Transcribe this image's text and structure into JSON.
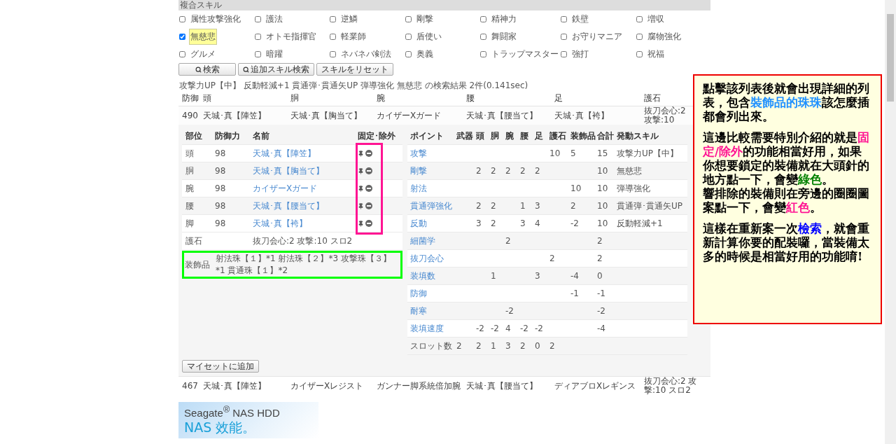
{
  "skill_section": {
    "title": "複合スキル",
    "skills": [
      {
        "label": "属性攻撃強化",
        "checked": false
      },
      {
        "label": "護法",
        "checked": false
      },
      {
        "label": "逆鱗",
        "checked": false
      },
      {
        "label": "剛撃",
        "checked": false
      },
      {
        "label": "精神力",
        "checked": false
      },
      {
        "label": "鉄壁",
        "checked": false
      },
      {
        "label": "増収",
        "checked": false
      },
      {
        "label": "無慈悲",
        "checked": true
      },
      {
        "label": "オトモ指揮官",
        "checked": false
      },
      {
        "label": "軽業師",
        "checked": false
      },
      {
        "label": "盾使い",
        "checked": false
      },
      {
        "label": "舞闘家",
        "checked": false
      },
      {
        "label": "お守りマニア",
        "checked": false
      },
      {
        "label": "腐物強化",
        "checked": false
      },
      {
        "label": "グルメ",
        "checked": false
      },
      {
        "label": "暗躍",
        "checked": false
      },
      {
        "label": "ネバネバ剣法",
        "checked": false
      },
      {
        "label": "奥義",
        "checked": false
      },
      {
        "label": "トラップマスター",
        "checked": false
      },
      {
        "label": "強打",
        "checked": false
      },
      {
        "label": "祝福",
        "checked": false
      }
    ]
  },
  "buttons": [
    {
      "label": "検索",
      "kind": "search"
    },
    {
      "label": "追加スキル検索",
      "kind": "search"
    },
    {
      "label": "スキルをリセット",
      "kind": "plain"
    }
  ],
  "result_summary": "攻撃力UP【中】 反動軽減+1 貫通弾･貫通矢UP 弾導強化 無慈悲 の検索結果 2件(0.141sec)",
  "results": {
    "columns": [
      "防御",
      "頭",
      "胴",
      "腕",
      "腰",
      "足",
      "護石"
    ],
    "rows": [
      {
        "expanded": true,
        "cells": [
          "490",
          "天城･真【陣笠】",
          "天城･真【胸当て】",
          "カイザーXガード",
          "天城･真【腰当て】",
          "天城･真【袴】",
          "抜刀会心:2 攻撃:10"
        ],
        "detail": {
          "parts_table": {
            "columns": [
              "部位",
              "防御力",
              "名前",
              "固定･除外"
            ],
            "rows": [
              {
                "part": "頭",
                "defense": "98",
                "name": "天城･真【陣笠】"
              },
              {
                "part": "胴",
                "defense": "98",
                "name": "天城･真【胸当て】"
              },
              {
                "part": "腕",
                "defense": "98",
                "name": "カイザーXガード"
              },
              {
                "part": "腰",
                "defense": "98",
                "name": "天城･真【腰当て】"
              },
              {
                "part": "脚",
                "defense": "98",
                "name": "天城･真【袴】"
              }
            ],
            "charm": {
              "label": "護石",
              "text": "抜刀会心:2 攻撃:10 スロ2"
            },
            "decorations": {
              "label": "装飾品",
              "text": "射法珠【１】*1 射法珠【２】*3 攻撃珠【３】*1 貫通珠【１】*2"
            }
          },
          "points_table": {
            "columns": [
              "ポイント",
              "武器",
              "頭",
              "胴",
              "腕",
              "腰",
              "足",
              "護石",
              "装飾品",
              "合計",
              "発動スキル"
            ],
            "rows": [
              {
                "kind": "skill",
                "point": "攻撃",
                "values": {
                  "charm": "10",
                  "decorations": "5",
                  "total": "15"
                },
                "skill": "攻撃力UP【中】"
              },
              {
                "kind": "skill",
                "point": "剛撃",
                "values": {
                  "head": "2",
                  "body": "2",
                  "arm": "2",
                  "waist": "2",
                  "leg": "2",
                  "total": "10"
                },
                "skill": "無慈悲"
              },
              {
                "kind": "skill",
                "point": "射法",
                "values": {
                  "decorations": "10",
                  "total": "10"
                },
                "skill": "弾導強化"
              },
              {
                "kind": "skill",
                "point": "貫通弾強化",
                "values": {
                  "head": "2",
                  "body": "2",
                  "waist": "1",
                  "leg": "3",
                  "decorations": "2",
                  "total": "10"
                },
                "skill": "貫通弾･貫通矢UP"
              },
              {
                "kind": "skill",
                "point": "反動",
                "values": {
                  "head": "3",
                  "body": "2",
                  "waist": "3",
                  "leg": "4",
                  "decorations": "-2",
                  "total": "10"
                },
                "skill": "反動軽減+1"
              },
              {
                "kind": "skill",
                "point": "細菌学",
                "values": {
                  "arm": "2",
                  "total": "2"
                }
              },
              {
                "kind": "skill",
                "point": "抜刀会心",
                "values": {
                  "charm": "2",
                  "total": "2"
                }
              },
              {
                "kind": "skill",
                "point": "装填数",
                "values": {
                  "body": "1",
                  "leg": "3",
                  "decorations": "-4",
                  "total": "0"
                }
              },
              {
                "kind": "skill",
                "point": "防御",
                "values": {
                  "decorations": "-1",
                  "total": "-1"
                }
              },
              {
                "kind": "skill",
                "point": "耐寒",
                "values": {
                  "arm": "-2",
                  "total": "-2"
                }
              },
              {
                "kind": "skill",
                "point": "装填速度",
                "values": {
                  "head": "-2",
                  "body": "-2",
                  "arm": "4",
                  "waist": "-2",
                  "leg": "-2",
                  "total": "-4"
                }
              },
              {
                "kind": "slots",
                "point": "スロット数",
                "values": {
                  "weapon": "2",
                  "head": "2",
                  "body": "1",
                  "arm": "3",
                  "waist": "2",
                  "leg": "0",
                  "charm": "2"
                }
              }
            ]
          },
          "add_button": "マイセットに追加"
        }
      },
      {
        "expanded": false,
        "cells": [
          "467",
          "天城･真【陣笠】",
          "カイザーXレジスト",
          "ガンナー脚系統倍加腕",
          "天城･真【腰当て】",
          "ディアブロXレギンス",
          "抜刀会心:2 攻撃:10 スロ2"
        ]
      }
    ]
  },
  "ad": {
    "brand": "Seagate$^{®}$ NAS HDD",
    "headline": "NAS 效能。"
  },
  "annotation": {
    "paragraphs": [
      {
        "lines": [
          [
            {
              "text": "點擊該列表後就會出現詳細的列表，包含"
            },
            {
              "text": "裝飾品的珠珠",
              "color": "#1e90ff"
            },
            {
              "text": "該怎麼插都會列出來。"
            }
          ]
        ]
      },
      {
        "lines": [
          [
            {
              "text": "這邊比較需要特別介紹的就是"
            },
            {
              "text": "固定/除外",
              "color": "#ff1493"
            },
            {
              "text": "的功能相當好用，如果你想要鎖定的裝備就在大頭針的地方點一下，會變"
            },
            {
              "text": "綠色",
              "color": "#008000"
            },
            {
              "text": "。"
            }
          ],
          [
            {
              "text": "響排除的裝備則在旁邊的圈圈圖案點一下，會變"
            },
            {
              "text": "紅色",
              "color": "#ff1493"
            },
            {
              "text": "。"
            }
          ]
        ]
      },
      {
        "lines": [
          [
            {
              "text": "這樣在重新案一次"
            },
            {
              "text": "檢索",
              "color": "#0000ff"
            },
            {
              "text": "，就會重新計算你要的配裝囉，當裝備太多的時候是相當好用的功能唷!"
            }
          ]
        ]
      }
    ]
  }
}
